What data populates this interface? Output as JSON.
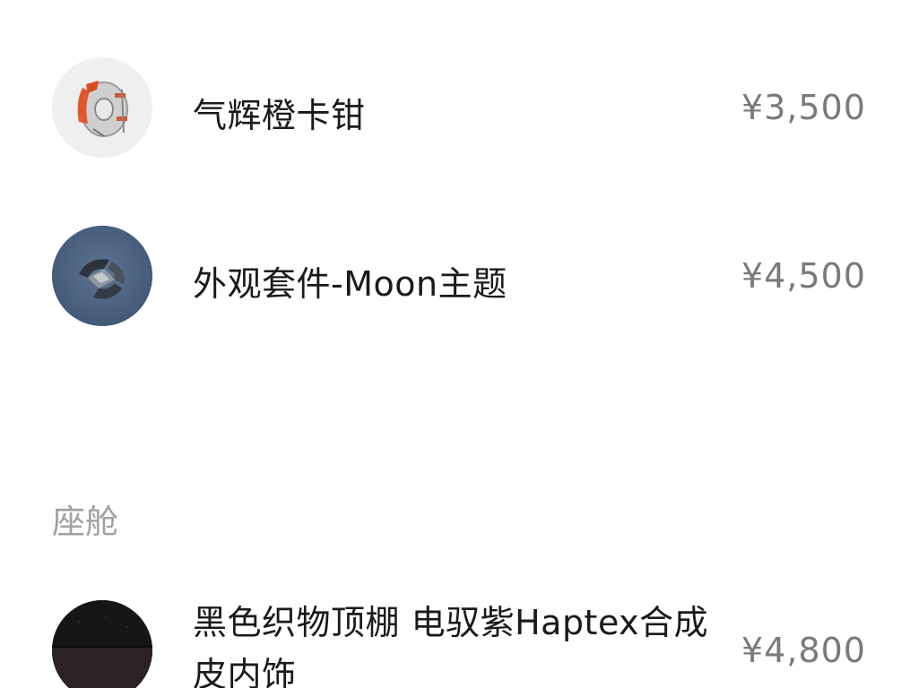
{
  "options": [
    {
      "name": "气辉橙卡钳",
      "price": "¥3,500",
      "icon": "orange-brake-caliper-icon"
    },
    {
      "name": "外观套件-Moon主题",
      "price": "¥4,500",
      "icon": "moon-theme-wheel-icon"
    }
  ],
  "sections": [
    {
      "label": "座舱",
      "items": [
        {
          "name": "黑色织物顶棚 电驭紫Haptex合成皮内饰",
          "price": "¥4,800",
          "icon": "interior-fabric-swatch-icon"
        }
      ]
    }
  ],
  "colors": {
    "text_primary": "#1a1a1a",
    "text_price": "#7a7a7a",
    "text_section": "#a0a0a0",
    "background": "#ffffff"
  }
}
